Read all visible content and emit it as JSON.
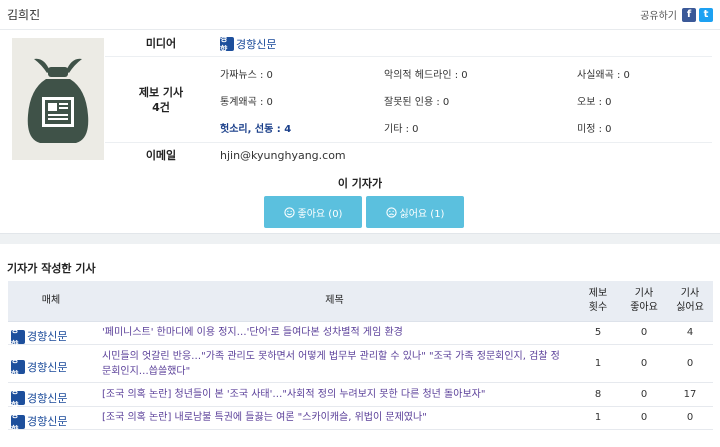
{
  "reporter": {
    "name": "김희진"
  },
  "share": {
    "label": "공유하기",
    "facebook": "f",
    "twitter": "t"
  },
  "profile": {
    "media_label": "미디어",
    "media_name": "경향신문",
    "media_logo_text": "경향",
    "reports_label_line1": "제보 기사",
    "reports_label_line2": "4건",
    "stats": [
      {
        "label": "가짜뉴스 : 0",
        "highlight": false
      },
      {
        "label": "악의적 헤드라인 : 0",
        "highlight": false
      },
      {
        "label": "사실왜곡 : 0",
        "highlight": false
      },
      {
        "label": "통계왜곡 : 0",
        "highlight": false
      },
      {
        "label": "잘못된 인용 : 0",
        "highlight": false
      },
      {
        "label": "오보 : 0",
        "highlight": false
      },
      {
        "label": "헛소리, 선동 : 4",
        "highlight": true
      },
      {
        "label": "기타 : 0",
        "highlight": false
      },
      {
        "label": "미정 : 0",
        "highlight": false
      }
    ],
    "email_label": "이메일",
    "email": "hjin@kyunghyang.com"
  },
  "reaction": {
    "title": "이 기자가",
    "like_label": "좋아요 (0)",
    "dislike_label": "싫어요 (1)",
    "like_icon": "smile-icon",
    "dislike_icon": "frown-icon"
  },
  "articles": {
    "section_title": "기자가 작성한 기사",
    "headers": {
      "media": "매체",
      "title": "제목",
      "reports_line1": "제보",
      "reports_line2": "횟수",
      "likes_line1": "기사",
      "likes_line2": "좋아요",
      "dislikes_line1": "기사",
      "dislikes_line2": "싫어요"
    },
    "rows": [
      {
        "media": "경향신문",
        "title": "'페미니스트' 한마디에 이용 정지…'단어'로 들여다본 성차별적 게임 환경",
        "reports": "5",
        "likes": "0",
        "dislikes": "4"
      },
      {
        "media": "경향신문",
        "title": "시민들의 엇갈린 반응…\"가족 관리도 못하면서 어떻게 법무부 관리할 수 있나\" \"조국 가족 정문회인지, 검찰 정문회인지…씁쓸했다\"",
        "reports": "1",
        "likes": "0",
        "dislikes": "0"
      },
      {
        "media": "경향신문",
        "title": "[조국 의혹 논란] 청년들이 본 '조국 사태'…\"사회적 정의 누려보지 못한 다른 청년 돌아보자\"",
        "reports": "8",
        "likes": "0",
        "dislikes": "17"
      },
      {
        "media": "경향신문",
        "title": "[조국 의혹 논란] 내로남불 특권에 들끓는 여론 \"스카이캐슬, 위법이 문제였나\"",
        "reports": "1",
        "likes": "0",
        "dislikes": "0"
      }
    ]
  }
}
